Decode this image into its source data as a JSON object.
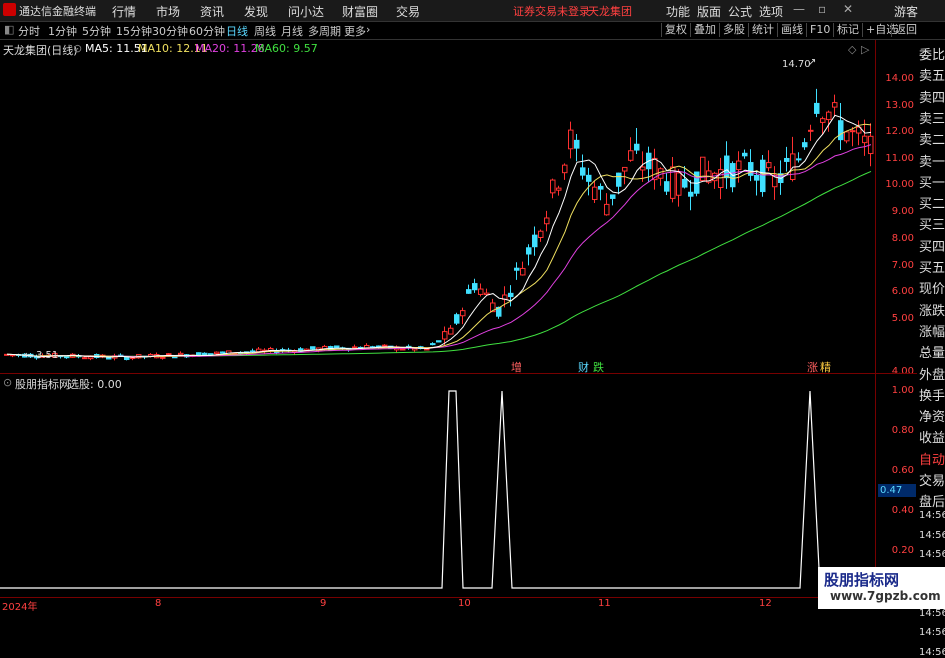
{
  "titlebar": {
    "app_name": "通达信金融终端",
    "menus": [
      "行情",
      "市场",
      "资讯",
      "发现",
      "问小达",
      "财富圈",
      "交易"
    ],
    "alert": "证券交易未登录",
    "stock": "天龙集团",
    "right_menus": [
      "功能",
      "版面",
      "公式",
      "选项"
    ],
    "guest": "游客"
  },
  "toolbar": {
    "timeframes": [
      "分时",
      "1分钟",
      "5分钟",
      "15分钟",
      "30分钟",
      "60分钟",
      "日线",
      "周线",
      "月线",
      "多周期",
      "更多"
    ],
    "active": "日线",
    "buttons": [
      "复权",
      "叠加",
      "多股",
      "统计",
      "画线",
      "F10",
      "标记",
      "+自选",
      "返回"
    ]
  },
  "main_chart": {
    "title": "天龙集团(日线)",
    "ma5_label": "MA5: 11.51",
    "ma10_label": "MA10: 12.11",
    "ma20_label": "MA20: 11.28",
    "ma60_label": "MA60: 9.57",
    "colors": {
      "ma5": "#ffffff",
      "ma10": "#f0e060",
      "ma20": "#e040e0",
      "ma60": "#40e040",
      "up": "#ff3030",
      "down": "#40e0ff"
    },
    "high_label": "14.70",
    "low_label": "3.51",
    "markers": [
      {
        "text": "增",
        "color": "#ff6060"
      },
      {
        "text": "财",
        "color": "#5ad8ff"
      },
      {
        "text": "跌",
        "color": "#40e040"
      },
      {
        "text": "涨",
        "color": "#ff6060"
      },
      {
        "text": "精",
        "color": "#ffcc40"
      }
    ],
    "y_ticks": [
      "14.00",
      "13.00",
      "12.00",
      "11.00",
      "10.00",
      "9.00",
      "8.00",
      "7.00",
      "6.00",
      "5.00",
      "4.00"
    ]
  },
  "sub_chart": {
    "title": "股朋指标网",
    "value_label": "选股: 0.00",
    "y_ticks": [
      "1.00",
      "0.80",
      "0.60",
      "0.40",
      "0.20"
    ],
    "current_value": "0.47"
  },
  "dates": [
    "2024年",
    "8",
    "9",
    "10",
    "11",
    "12"
  ],
  "side_panel": {
    "labels": [
      "委比",
      "卖五",
      "卖四",
      "卖三",
      "卖二",
      "卖一",
      "买一",
      "买二",
      "买三",
      "买四",
      "买五",
      "现价",
      "涨跌",
      "涨幅",
      "总量",
      "外盘",
      "换手",
      "净资",
      "收益",
      "自动",
      "交易",
      "盘后",
      "14:56",
      "14:56",
      "14:56",
      "14:56",
      "14:56",
      "14:56",
      "14:56",
      "14:56"
    ]
  },
  "watermark": {
    "line1": "股朋指标网",
    "line2": "www.7gpzb.com"
  }
}
